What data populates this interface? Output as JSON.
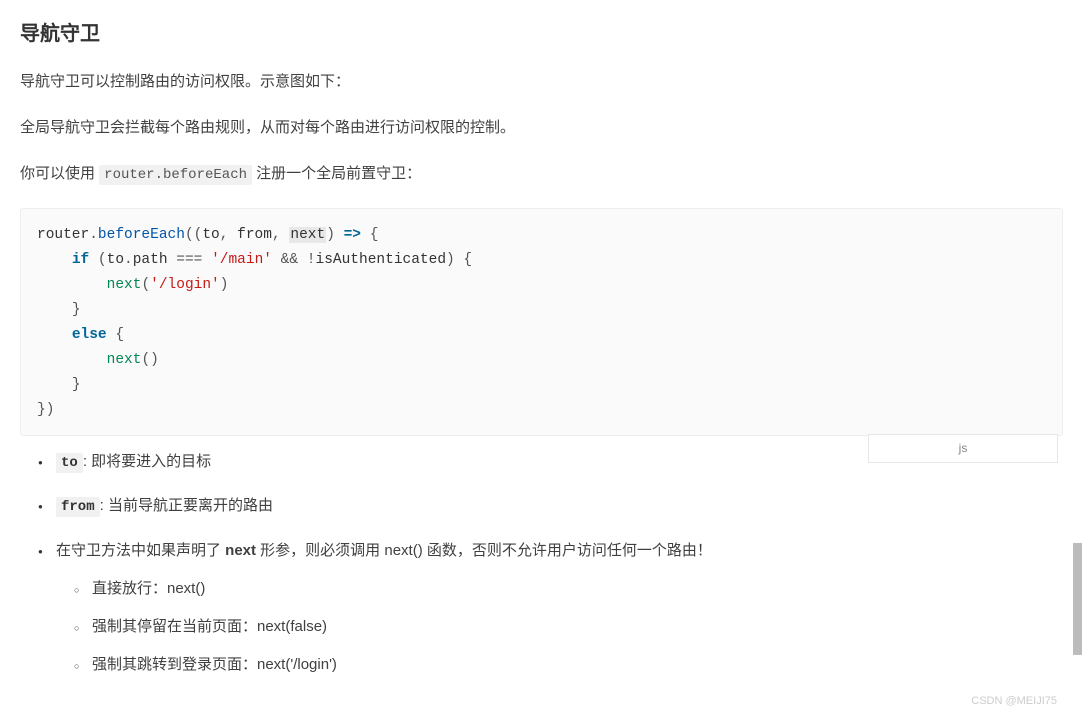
{
  "title": "导航守卫",
  "para1": "导航守卫可以控制路由的访问权限。示意图如下：",
  "para2": "全局导航守卫会拦截每个路由规则，从而对每个路由进行访问权限的控制。",
  "para3_pre": "你可以使用 ",
  "para3_code": "router.beforeEach",
  "para3_post": " 注册一个全局前置守卫：",
  "code": {
    "lang_label": "js",
    "tokens": {
      "router": "router",
      "dot": ".",
      "beforeEach": "beforeEach",
      "open": "((",
      "to": "to",
      "comma": ", ",
      "from": "from",
      "next": "next",
      "close_param": ") ",
      "arrow": "=>",
      "brace_open": " {",
      "if": "if",
      "lparen": " (",
      "path": "path",
      "eq": " === ",
      "str_main": "'/main'",
      "and": " && ",
      "not": "!",
      "isAuth": "isAuthenticated",
      "rparen_brace": ") {",
      "str_login": "'/login'",
      "rparen": ")",
      "rbrace": "}",
      "else": "else",
      "empty_call": "()",
      "end": "})"
    }
  },
  "bullets": {
    "b1_code": "to",
    "b1_text": ": 即将要进入的目标",
    "b2_code": "from",
    "b2_text": ": 当前导航正要离开的路由",
    "b3_pre": "在守卫方法中如果声明了 ",
    "b3_strong": "next",
    "b3_post": " 形参，则必须调用 next() 函数，否则不允许用户访问任何一个路由！",
    "sub1": "直接放行：next()",
    "sub2": "强制其停留在当前页面：next(false)",
    "sub3": "强制其跳转到登录页面：next('/login')"
  },
  "watermark": "CSDN @MEIJI75"
}
